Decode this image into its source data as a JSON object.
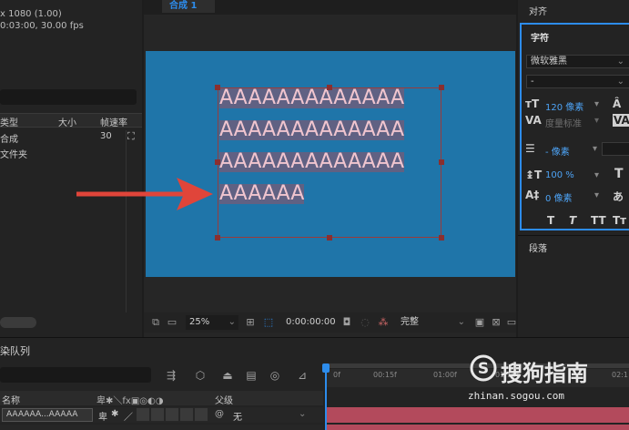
{
  "project": {
    "meta_line1": "x 1080 (1.00)",
    "meta_line2": "0:03:00, 30.00 fps",
    "columns": {
      "type": "类型",
      "size": "大小",
      "fps": "帧速率"
    },
    "rows": [
      {
        "label": "合成",
        "fps": "30"
      },
      {
        "label": "文件夹",
        "fps": ""
      }
    ]
  },
  "viewer": {
    "tab_label": "合成 1",
    "text_lines": [
      "AAAAAAAAAAAAA",
      "AAAAAAAAAAAAA",
      "AAAAAAAAAAAAA",
      "AAAAAA"
    ],
    "zoom": "25%",
    "timecode": "0:00:00:00",
    "quality": "完整",
    "colors": {
      "canvas": "#1f75a9",
      "selection": "#96506480",
      "text": "#f0c5cf",
      "arrow": "#e0453a"
    }
  },
  "right_panel": {
    "align_title": "对齐",
    "char_title": "字符",
    "font_family": "微软雅黑",
    "font_style": "-",
    "font_size": "120 像素",
    "kerning": "度量标准",
    "leading": "- 像素",
    "vscale": "100 %",
    "baseline": "0 像素",
    "style_buttons": [
      "T",
      "T",
      "TT",
      "Tт"
    ],
    "para_title": "段落"
  },
  "timeline": {
    "render_title": "染队列",
    "layer_columns": {
      "name": "名称",
      "parent": "父级"
    },
    "layer_name": "AAAAAA...AAAAA",
    "parent_value": "无",
    "ruler_ticks": [
      "0f",
      "00:15f",
      "01:00f",
      "01:15f",
      "02:1"
    ]
  },
  "watermark": {
    "brand": "搜狗指南",
    "url": "zhinan.sogou.com"
  }
}
